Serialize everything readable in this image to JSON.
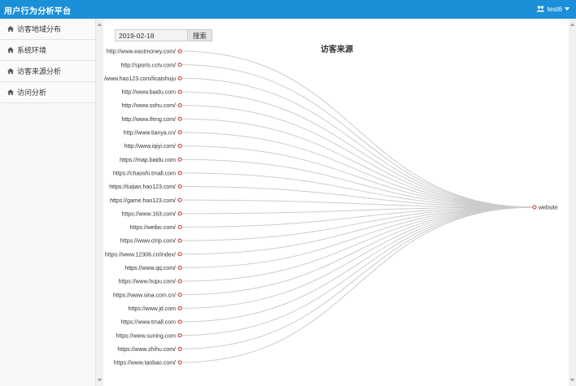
{
  "header": {
    "title": "用户行为分析平台",
    "user_name": "test6",
    "accent": "#1b8fd7"
  },
  "sidebar": {
    "items": [
      {
        "label": "访客地域分布",
        "icon": "home-icon"
      },
      {
        "label": "系统环境",
        "icon": "home-icon"
      },
      {
        "label": "访客来源分析",
        "icon": "home-icon"
      },
      {
        "label": "访问分析",
        "icon": "home-icon"
      }
    ]
  },
  "search": {
    "date_value": "2019-02-18",
    "button_label": "搜索"
  },
  "chart_data": {
    "type": "tree",
    "title": "访客来源",
    "root": "website",
    "sources": [
      "http://www.eastmoney.com/",
      "http://sports.cctv.com/",
      "http://www.hao123.com/licaishuju",
      "http://www.baidu.com",
      "http://www.sohu.com/",
      "http://www.ifeng.com/",
      "http://www.tianya.cn/",
      "http://www.iqiyi.com/",
      "https://map.baidu.com",
      "https://chaoshi.tmall.com",
      "https://tuijian.hao123.com/",
      "https://game.hao123.com/",
      "https://www.163.com/",
      "https://weibo.com/",
      "https://www.ctrip.com/",
      "https://www.12306.cn/index/",
      "https://www.qq.com/",
      "https://www.hupu.com/",
      "https://www.sina.com.cn/",
      "https://www.jd.com",
      "https://www.tmall.com",
      "https://www.suning.com",
      "https://www.zhihu.com/",
      "https://www.taobao.com/"
    ],
    "link_color": "#cccccc",
    "node_color": "#c23531"
  }
}
